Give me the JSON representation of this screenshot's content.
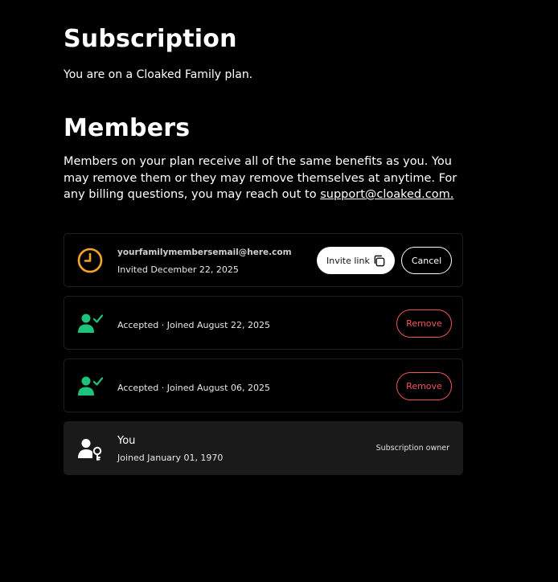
{
  "subscription": {
    "title": "Subscription",
    "plan_text": "You are on a Cloaked Family plan."
  },
  "members": {
    "title": "Members",
    "description": "Members on your plan receive all of the same benefits as you. You may remove them or they may remove themselves at anytime. For any billing questions, you may reach out to ",
    "support_email": "support@cloaked.com.",
    "list": [
      {
        "icon": "clock-icon",
        "email": "yourfamilymembersemail@here.com",
        "status": "Invited December 22, 2025",
        "invite_label": "Invite link",
        "cancel_label": "Cancel"
      },
      {
        "icon": "user-check-icon",
        "status": "Accepted · Joined August 22, 2025",
        "remove_label": "Remove"
      },
      {
        "icon": "user-check-icon",
        "status": "Accepted · Joined August 06, 2025",
        "remove_label": "Remove"
      },
      {
        "icon": "user-key-icon",
        "name": "You",
        "status": "Joined January 01, 1970",
        "role": "Subscription owner"
      }
    ]
  },
  "colors": {
    "background": "#000000",
    "pending": "#f5a623",
    "accepted": "#1fc27a",
    "danger": "#f0565a",
    "owner_card": "#1a1a1a"
  }
}
